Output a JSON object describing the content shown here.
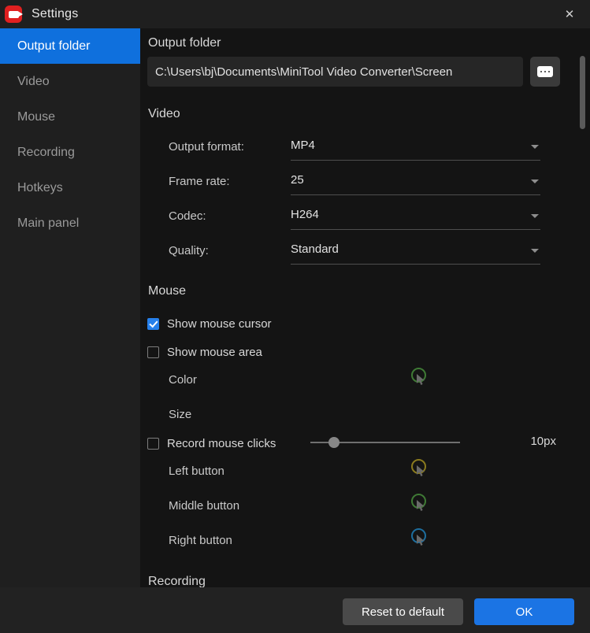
{
  "window": {
    "title": "Settings",
    "app_icon": "video-camera-icon",
    "close_icon": "close-icon"
  },
  "sidebar": {
    "items": [
      {
        "label": "Output folder",
        "active": true
      },
      {
        "label": "Video",
        "active": false
      },
      {
        "label": "Mouse",
        "active": false
      },
      {
        "label": "Recording",
        "active": false
      },
      {
        "label": "Hotkeys",
        "active": false
      },
      {
        "label": "Main panel",
        "active": false
      }
    ]
  },
  "main": {
    "output_folder": {
      "heading": "Output folder",
      "path": "C:\\Users\\bj\\Documents\\MiniTool Video Converter\\Screen",
      "browse_label": "…",
      "browse_icon": "ellipsis-icon"
    },
    "video": {
      "heading": "Video",
      "fields": [
        {
          "label": "Output format:",
          "value": "MP4"
        },
        {
          "label": "Frame rate:",
          "value": "25"
        },
        {
          "label": "Codec:",
          "value": "H264"
        },
        {
          "label": "Quality:",
          "value": "Standard"
        }
      ]
    },
    "mouse": {
      "heading": "Mouse",
      "show_cursor": {
        "label": "Show mouse cursor",
        "checked": true
      },
      "show_area": {
        "label": "Show mouse area",
        "checked": false
      },
      "color": {
        "label": "Color",
        "value": "#3f7a35"
      },
      "size": {
        "label": "Size",
        "value": "10px",
        "percent": 15
      },
      "record_clicks": {
        "label": "Record mouse clicks",
        "checked": false
      },
      "buttons": [
        {
          "label": "Left button",
          "color": "#8a7a1e"
        },
        {
          "label": "Middle button",
          "color": "#3f7a35"
        },
        {
          "label": "Right button",
          "color": "#1d6e9e"
        }
      ]
    },
    "recording": {
      "heading": "Recording"
    }
  },
  "footer": {
    "reset_label": "Reset to default",
    "ok_label": "OK"
  },
  "colors": {
    "accent": "#0f70dd",
    "primary_button": "#1b74e4",
    "checkbox": "#2680eb",
    "app_icon": "#e02020"
  }
}
